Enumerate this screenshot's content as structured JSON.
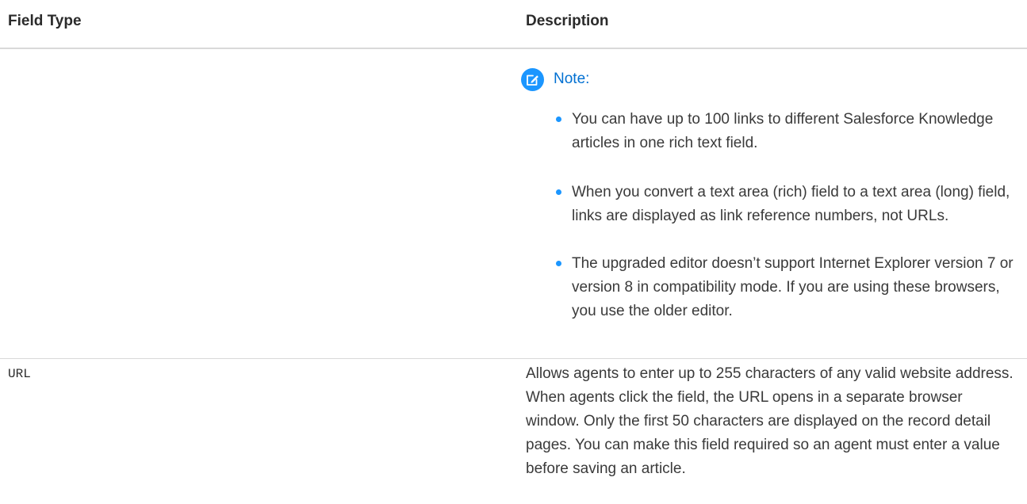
{
  "table": {
    "headers": {
      "field_type": "Field Type",
      "description": "Description"
    },
    "rows": [
      {
        "field_type": "",
        "note": {
          "icon": "edit-note-icon",
          "title": "Note:",
          "accent_color": "#1b96ff",
          "title_color": "#0070d2",
          "bullets": [
            "You can have up to 100 links to different Salesforce Knowledge articles in one rich text field.",
            "When you convert a text area (rich) field to a text area (long) field, links are displayed as link reference numbers, not URLs.",
            "The upgraded editor doesn’t support Internet Explorer version 7 or version 8 in compatibility mode. If you are using these browsers, you use the older editor."
          ]
        }
      },
      {
        "field_type": "URL",
        "description": "Allows agents to enter up to 255 characters of any valid website address. When agents click the field, the URL opens in a separate browser window. Only the first 50 characters are displayed on the record detail pages. You can make this field required so an agent must enter a value before saving an article."
      }
    ]
  }
}
